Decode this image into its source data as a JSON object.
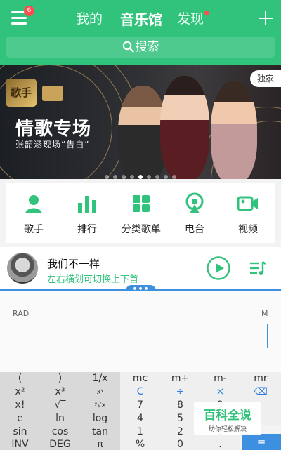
{
  "topbar": {
    "badge": "6",
    "tabs": [
      {
        "label": "我的"
      },
      {
        "label": "音乐馆"
      },
      {
        "label": "发现"
      }
    ],
    "search_label": "搜索"
  },
  "banner": {
    "exclusive_label": "独家",
    "title": "情歌专场",
    "subtitle": "张韶涵现场“告白”",
    "logo_text": "歌手"
  },
  "categories": [
    {
      "label": "歌手",
      "icon": "singer-icon"
    },
    {
      "label": "排行",
      "icon": "ranking-icon"
    },
    {
      "label": "分类歌单",
      "icon": "category-icon"
    },
    {
      "label": "电台",
      "icon": "radio-icon"
    },
    {
      "label": "视频",
      "icon": "video-icon"
    }
  ],
  "player": {
    "song_title": "我们不一样",
    "hint": "左右横划可切换上下首",
    "handle_text": "•••"
  },
  "calculator": {
    "mode": "RAD",
    "memory": "M",
    "keys": [
      [
        "(",
        ")",
        "1/x",
        "mc",
        "m+",
        "m-",
        "mr"
      ],
      [
        "x²",
        "x³",
        "xʸ",
        "C",
        "÷",
        "×",
        "⌫"
      ],
      [
        "x!",
        "√‾",
        "ʸ√x",
        "7",
        "8",
        "9",
        ""
      ],
      [
        "e",
        "ln",
        "log",
        "4",
        "5",
        "6",
        ""
      ],
      [
        "sin",
        "cos",
        "tan",
        "1",
        "2",
        "3",
        ""
      ],
      [
        "INV",
        "DEG",
        "π",
        "%",
        "0",
        ".",
        ""
      ]
    ],
    "equals": "="
  },
  "watermark": {
    "main": "百科全说",
    "sub": "助你轻松解决"
  },
  "colors": {
    "accent": "#31c27c",
    "calc_blue": "#3d8fe0"
  }
}
